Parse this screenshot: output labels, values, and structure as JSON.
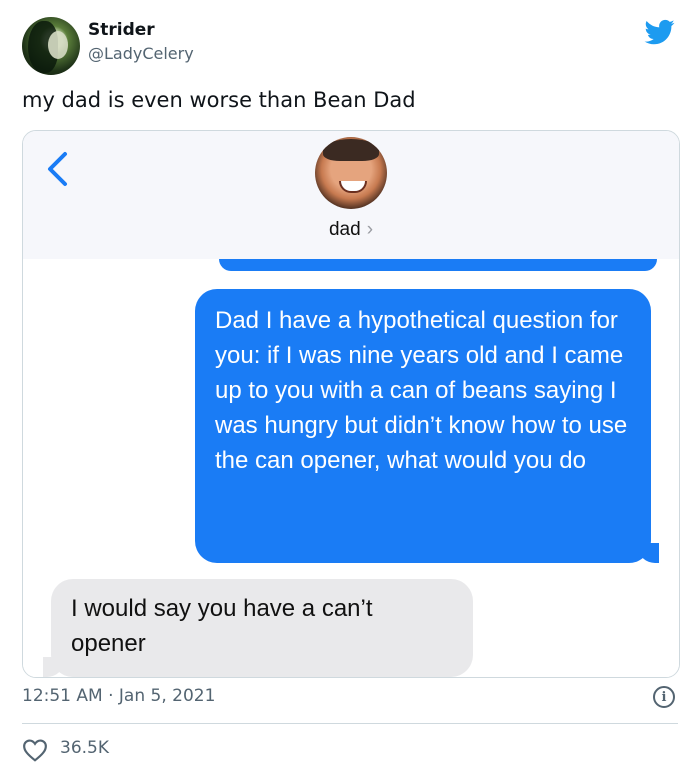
{
  "tweet": {
    "author_name": "Strider",
    "author_handle": "@LadyCelery",
    "text": "my dad is even worse than Bean Dad",
    "timestamp": "12:51 AM · Jan 5, 2021",
    "like_count": "36.5K"
  },
  "screenshot": {
    "contact_name": "dad",
    "contact_chevron": "›",
    "messages": [
      {
        "direction": "sent",
        "text": "Dad I have a hypothetical question for you: if I was nine years old and I came up to you with a can of beans saying I was hungry but didn’t know how to use the can opener, what would you do"
      },
      {
        "direction": "received",
        "text": "I would say you have a can’t opener"
      }
    ]
  },
  "icons": {
    "brand": "twitter-bird-icon",
    "back": "chevron-left-icon",
    "info": "info-icon",
    "like": "heart-icon"
  },
  "colors": {
    "twitter_blue": "#1d9bf0",
    "imessage_blue": "#1a7cf5",
    "received_gray": "#e9e9eb",
    "secondary_text": "#536471"
  },
  "info_glyph": "i"
}
